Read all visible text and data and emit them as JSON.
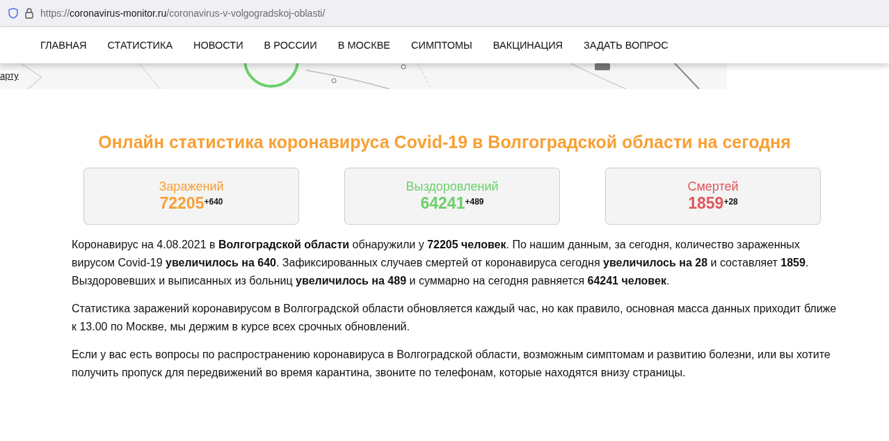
{
  "browser": {
    "url_prefix": "https://",
    "url_host": "coronavirus-monitor.ru",
    "url_path": "/coronavirus-v-volgogradskoj-oblasti/"
  },
  "nav": [
    "ГЛАВНАЯ",
    "СТАТИСТИКА",
    "НОВОСТИ",
    "В РОССИИ",
    "В МОСКВЕ",
    "СИМПТОМЫ",
    "ВАКЦИНАЦИЯ",
    "ЗАДАТЬ ВОПРОС"
  ],
  "map": {
    "kind": "picture",
    "link": "арту"
  },
  "heading": "Онлайн статистика коронавируса Covid-19 в Волгоградской области на сегодня",
  "stats": [
    {
      "label": "Заражений",
      "value": "72205",
      "delta": "+640",
      "color": "#f7a035"
    },
    {
      "label": "Выздоровлений",
      "value": "64241",
      "delta": "+489",
      "color": "#6ccf6b"
    },
    {
      "label": "Смертей",
      "value": "1859",
      "delta": "+28",
      "color": "#e0565b"
    }
  ],
  "paragraphs": [
    "Коронавирус на 4.08.2021 в **Волгоградской области** обнаружили у **72205 человек**. По нашим данным, за сегодня, количество зараженных вирусом Covid-19 **увеличилось на 640**. Зафиксированных случаев смертей от коронавируса сегодня **увеличилось на 28** и составляет **1859**. Выздоровевших и выписанных из больниц **увеличилось на 489** и суммарно на сегодня равняется **64241 человек**.",
    "Статистика заражений коронавирусом в Волгоградской области обновляется каждый час, но как правило, основная масса данных приходит ближе к 13.00 по Москве, мы держим в курсе всех срочных обновлений.",
    "Если у вас есть вопросы по распространению коронавируса в Волгоградской области, возможным симптомам и развитию болезни, или вы хотите получить пропуск для передвижений во время карантина, звоните по телефонам, которые находятся внизу страницы."
  ]
}
